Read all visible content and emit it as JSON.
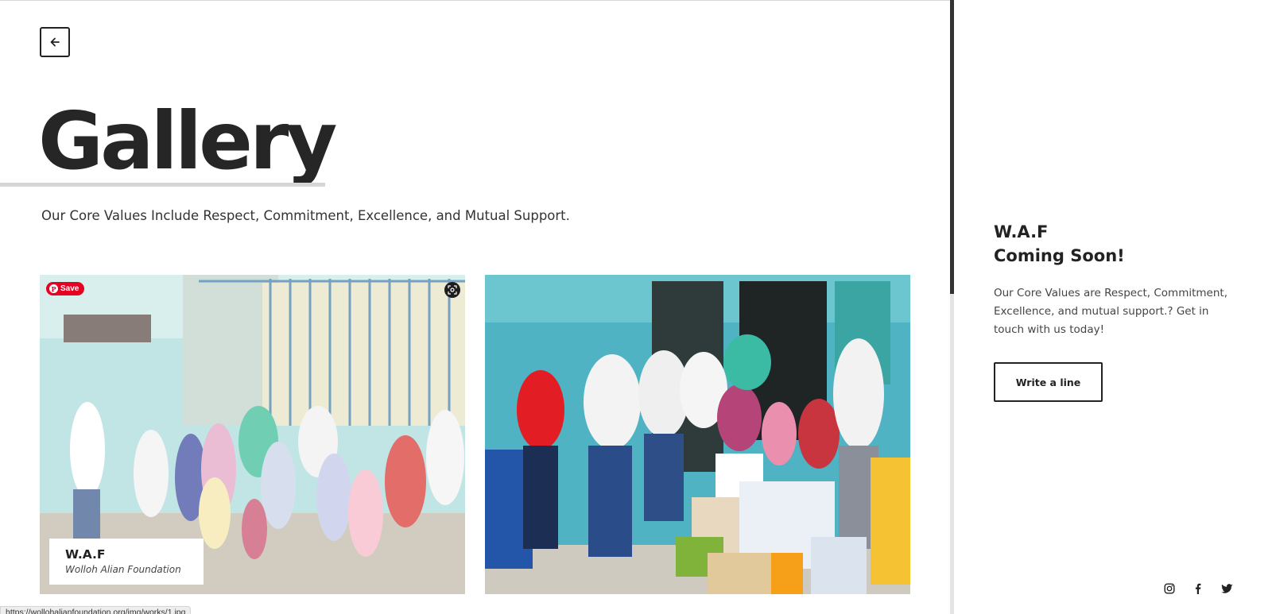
{
  "header": {
    "back_icon": "arrow-left-icon"
  },
  "page": {
    "title": "Gallery",
    "subtitle": "Our Core Values Include Respect, Commitment, Excellence, and Mutual Support."
  },
  "gallery": {
    "items": [
      {
        "caption_title": "W.A.F",
        "caption_subtitle": "Wolloh Alian Foundation",
        "save_label": "Save",
        "save_icon": "pinterest-icon",
        "lens_icon": "visual-search-icon"
      },
      {
        "caption_title": "",
        "caption_subtitle": ""
      }
    ]
  },
  "status_bar": {
    "url": "https://wollohalianfoundation.org/img/works/1.jpg"
  },
  "aside": {
    "brand": "W.A.F",
    "heading": "Coming Soon!",
    "text": "Our Core Values are Respect, Commitment, Excellence, and mutual support.? Get in touch with us today!",
    "button_label": "Write a line",
    "social": [
      "instagram-icon",
      "facebook-icon",
      "twitter-icon"
    ]
  },
  "colors": {
    "text_dark": "#222222",
    "pinterest_red": "#e60023",
    "divider_thumb": "#333333"
  }
}
